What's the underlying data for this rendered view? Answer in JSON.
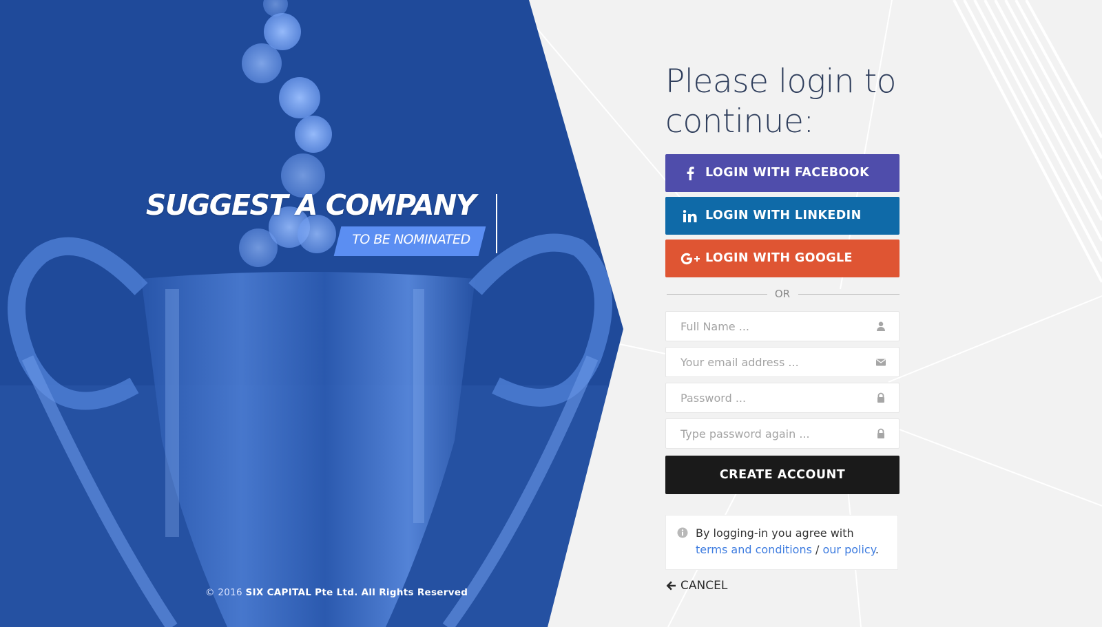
{
  "hero": {
    "title": "SUGGEST A COMPANY",
    "subtitle": "TO BE NOMINATED",
    "copyright_prefix": "© 2016",
    "copyright_brand": "SIX CAPITAL Pte Ltd. All Rights Reserved"
  },
  "login": {
    "heading": "Please login to continue:",
    "facebook_label": "LOGIN WITH FACEBOOK",
    "linkedin_label": "LOGIN WITH LINKEDIN",
    "google_label": "LOGIN WITH GOOGLE",
    "or_label": "OR",
    "fields": {
      "full_name_placeholder": "Full Name ...",
      "email_placeholder": "Your email address ...",
      "password_placeholder": "Password ...",
      "password_again_placeholder": "Type password again ..."
    },
    "create_label": "CREATE ACCOUNT",
    "terms": {
      "prefix": "By logging-in you agree with",
      "terms_link": "terms and conditions",
      "separator": "/",
      "policy_link": "our policy",
      "suffix": "."
    },
    "cancel_label": "CANCEL"
  },
  "colors": {
    "hero_blue": "#1f4a9a",
    "accent_blue": "#5b8ef2",
    "facebook": "#4f4dab",
    "linkedin": "#0f6aa8",
    "google": "#df5533",
    "create": "#1a1a1a",
    "link": "#3f7de0"
  },
  "icons": {
    "facebook": "facebook-icon",
    "linkedin": "linkedin-icon",
    "google": "google-plus-icon",
    "user": "user-icon",
    "email": "envelope-icon",
    "password": "lock-icon",
    "info": "info-icon",
    "cancel": "arrow-left-icon"
  }
}
